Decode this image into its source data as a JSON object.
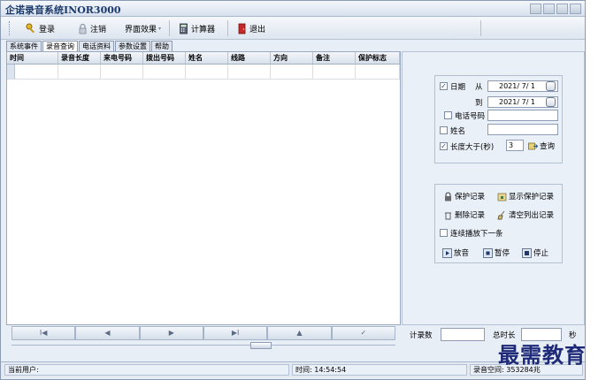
{
  "window": {
    "title": "企诺录音系统INOR3000"
  },
  "toolbar": {
    "login": "登录",
    "logout": "注销",
    "theme": "界面效果",
    "calculator": "计算器",
    "exit": "退出"
  },
  "tabs": [
    "系统事件",
    "录音查询",
    "电话资料",
    "参数设置",
    "帮助"
  ],
  "grid": {
    "columns": [
      "时间",
      "录音长度",
      "来电号码",
      "拨出号码",
      "姓名",
      "线路",
      "方向",
      "备注",
      "保护标志"
    ]
  },
  "query": {
    "date_label": "日期",
    "from_label": "从",
    "to_label": "到",
    "date_from": "2021/ 7/ 1",
    "date_to": "2021/ 7/ 1",
    "phone_label": "电话号码",
    "name_label": "姓名",
    "length_label": "长度大于(秒)",
    "length_value": "3",
    "search_label": "查询"
  },
  "actions": {
    "protect": "保护记录",
    "show_protected": "显示保护记录",
    "delete": "删除记录",
    "clear_list": "清空列出记录",
    "continuous": "连续播放下一条",
    "play": "放音",
    "pause": "暂停",
    "stop": "停止"
  },
  "nav": {
    "first": "I◀",
    "prev": "◀",
    "next": "▶",
    "last": "▶I",
    "up": "▲",
    "confirm": "✓"
  },
  "footer": {
    "count_label": "计录数",
    "total_label": "总时长",
    "unit": "秒"
  },
  "status": {
    "user_label": "当前用户:",
    "time": "时间: 14:54:54",
    "space": "录音空间: 353284兆"
  },
  "watermark": "最需教育"
}
